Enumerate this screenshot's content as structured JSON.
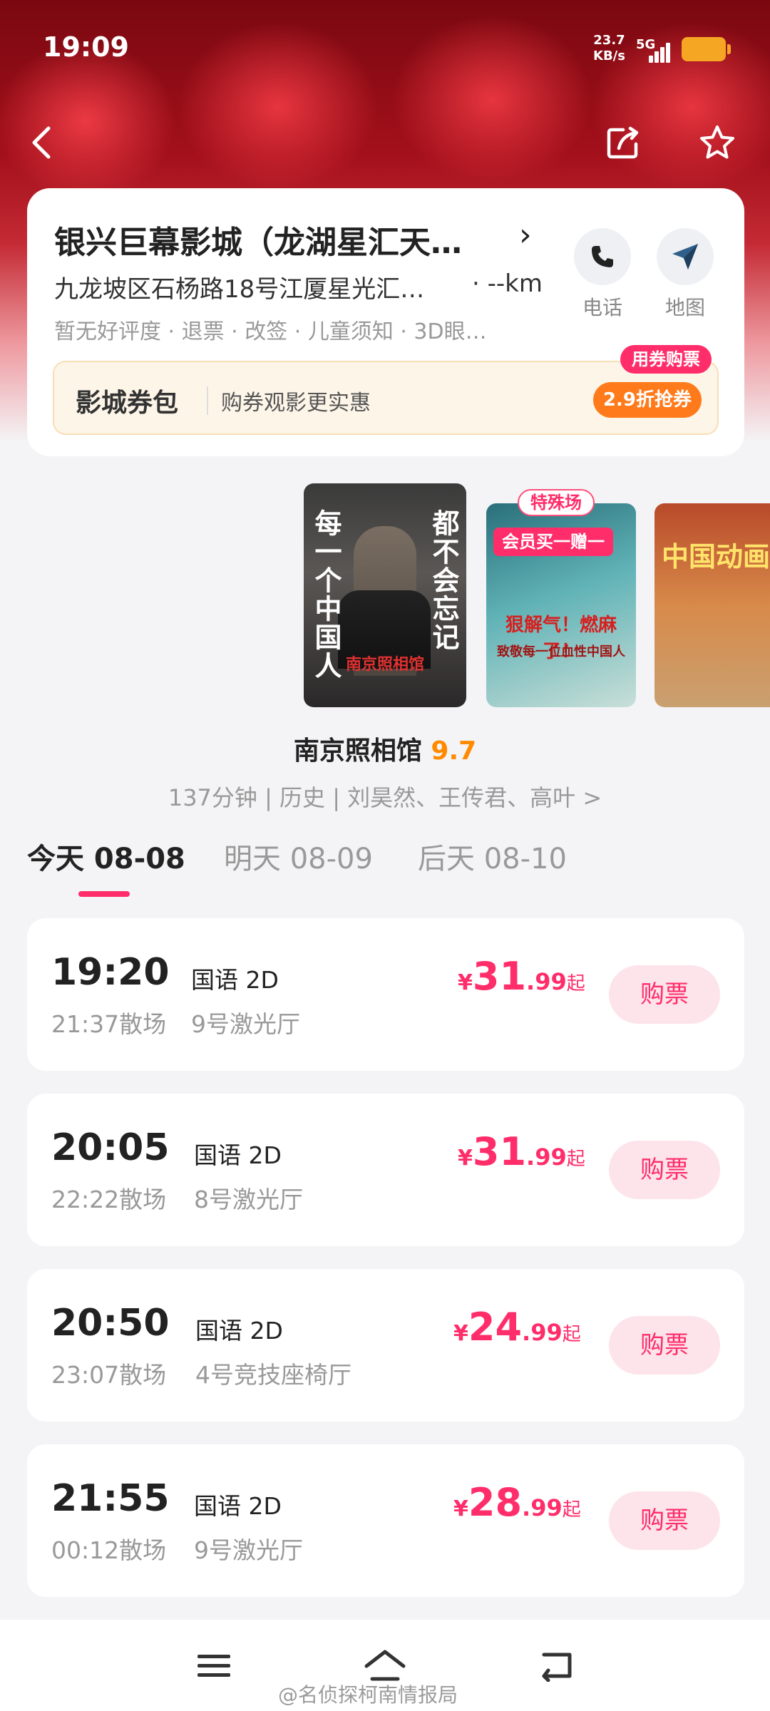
{
  "status_bar": {
    "time": "19:09",
    "net_speed_value": "23.7",
    "net_speed_unit": "KB/s",
    "network": "5G",
    "battery_color": "#f5a623"
  },
  "nav": {
    "back_icon": "back-arrow-icon",
    "share_icon": "share-icon",
    "favorite_icon": "star-icon"
  },
  "cinema": {
    "name": "银兴巨幕影城（龙湖星汇天…",
    "address": "九龙坡区石杨路18号江厦星光汇…",
    "distance": "· --km",
    "tags": "暂无好评度 · 退票 · 改签 · 儿童须知 · 3D眼…",
    "phone_label": "电话",
    "map_label": "地图"
  },
  "coupon": {
    "title": "影城券包",
    "description": "购券观影更实惠",
    "badge": "用券购票",
    "button": "2.9折抢券"
  },
  "posters": {
    "main_vertical_left": "每一个中国人",
    "main_vertical_right": "都不会忘记",
    "main_title": "南京照相馆",
    "second_special": "特殊场",
    "second_member": "会员买一赠一",
    "second_text": "狠解气！燃麻了！",
    "second_sub": "致敬每一位血性中国人",
    "third_text": "中国动画一定会"
  },
  "movie": {
    "name": "南京照相馆",
    "score": "9.7",
    "info": "137分钟 | 历史 | 刘昊然、王传君、高叶 >"
  },
  "date_tabs": [
    {
      "label": "今天 08-08",
      "active": true
    },
    {
      "label": "明天 08-09",
      "active": false
    },
    {
      "label": "后天 08-10",
      "active": false
    }
  ],
  "showtimes": [
    {
      "start": "19:20",
      "end": "21:37散场",
      "lang": "国语 2D",
      "hall": "9号激光厅",
      "currency": "¥",
      "price_int": "31",
      "price_dec": ".99",
      "price_suffix": "起",
      "buy": "购票"
    },
    {
      "start": "20:05",
      "end": "22:22散场",
      "lang": "国语 2D",
      "hall": "8号激光厅",
      "currency": "¥",
      "price_int": "31",
      "price_dec": ".99",
      "price_suffix": "起",
      "buy": "购票"
    },
    {
      "start": "20:50",
      "end": "23:07散场",
      "lang": "国语 2D",
      "hall": "4号竞技座椅厅",
      "currency": "¥",
      "price_int": "24",
      "price_dec": ".99",
      "price_suffix": "起",
      "buy": "购票"
    },
    {
      "start": "21:55",
      "end": "00:12散场",
      "lang": "国语 2D",
      "hall": "9号激光厅",
      "currency": "¥",
      "price_int": "28",
      "price_dec": ".99",
      "price_suffix": "起",
      "buy": "购票"
    }
  ],
  "bottom_nav": {
    "menu_icon": "menu-icon",
    "home_icon": "home-icon",
    "back_icon": "return-icon"
  },
  "watermark": "@名侦探柯南情报局",
  "colors": {
    "accent": "#ff2d6a",
    "score": "#ff8a00",
    "coupon_button": "#ff7a1a"
  }
}
